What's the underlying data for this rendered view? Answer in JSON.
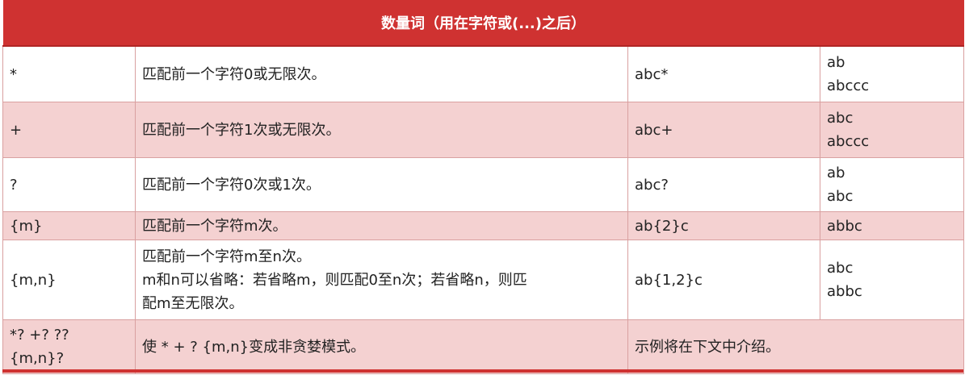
{
  "header": {
    "title": "数量词（用在字符或(...)之后）"
  },
  "rows": [
    {
      "syntax": "*",
      "desc": "匹配前一个字符0或无限次。",
      "example": "abc*",
      "matches": [
        "ab",
        "abccc"
      ]
    },
    {
      "syntax": "+",
      "desc": "匹配前一个字符1次或无限次。",
      "example": "abc+",
      "matches": [
        "abc",
        "abccc"
      ]
    },
    {
      "syntax": "?",
      "desc": "匹配前一个字符0次或1次。",
      "example": "abc?",
      "matches": [
        "ab",
        "abc"
      ]
    },
    {
      "syntax": "{m}",
      "desc": "匹配前一个字符m次。",
      "example": "ab{2}c",
      "matches": [
        "abbc"
      ]
    },
    {
      "syntax": "{m,n}",
      "desc_lines": [
        "匹配前一个字符m至n次。",
        "m和n可以省略：若省略m，则匹配0至n次；若省略n，则匹",
        "配m至无限次。"
      ],
      "example": "ab{1,2}c",
      "matches": [
        "abc",
        "abbc"
      ]
    },
    {
      "syntax_lines": [
        "*? +? ??",
        "{m,n}?"
      ],
      "desc": "使 * + ? {m,n}变成非贪婪模式。",
      "note": "示例将在下文中介绍。"
    }
  ],
  "colors": {
    "header_bg": "#cf3231",
    "row_alt_bg": "#f4d1d1",
    "border": "#d9a0a0",
    "header_text": "#ffffff"
  }
}
